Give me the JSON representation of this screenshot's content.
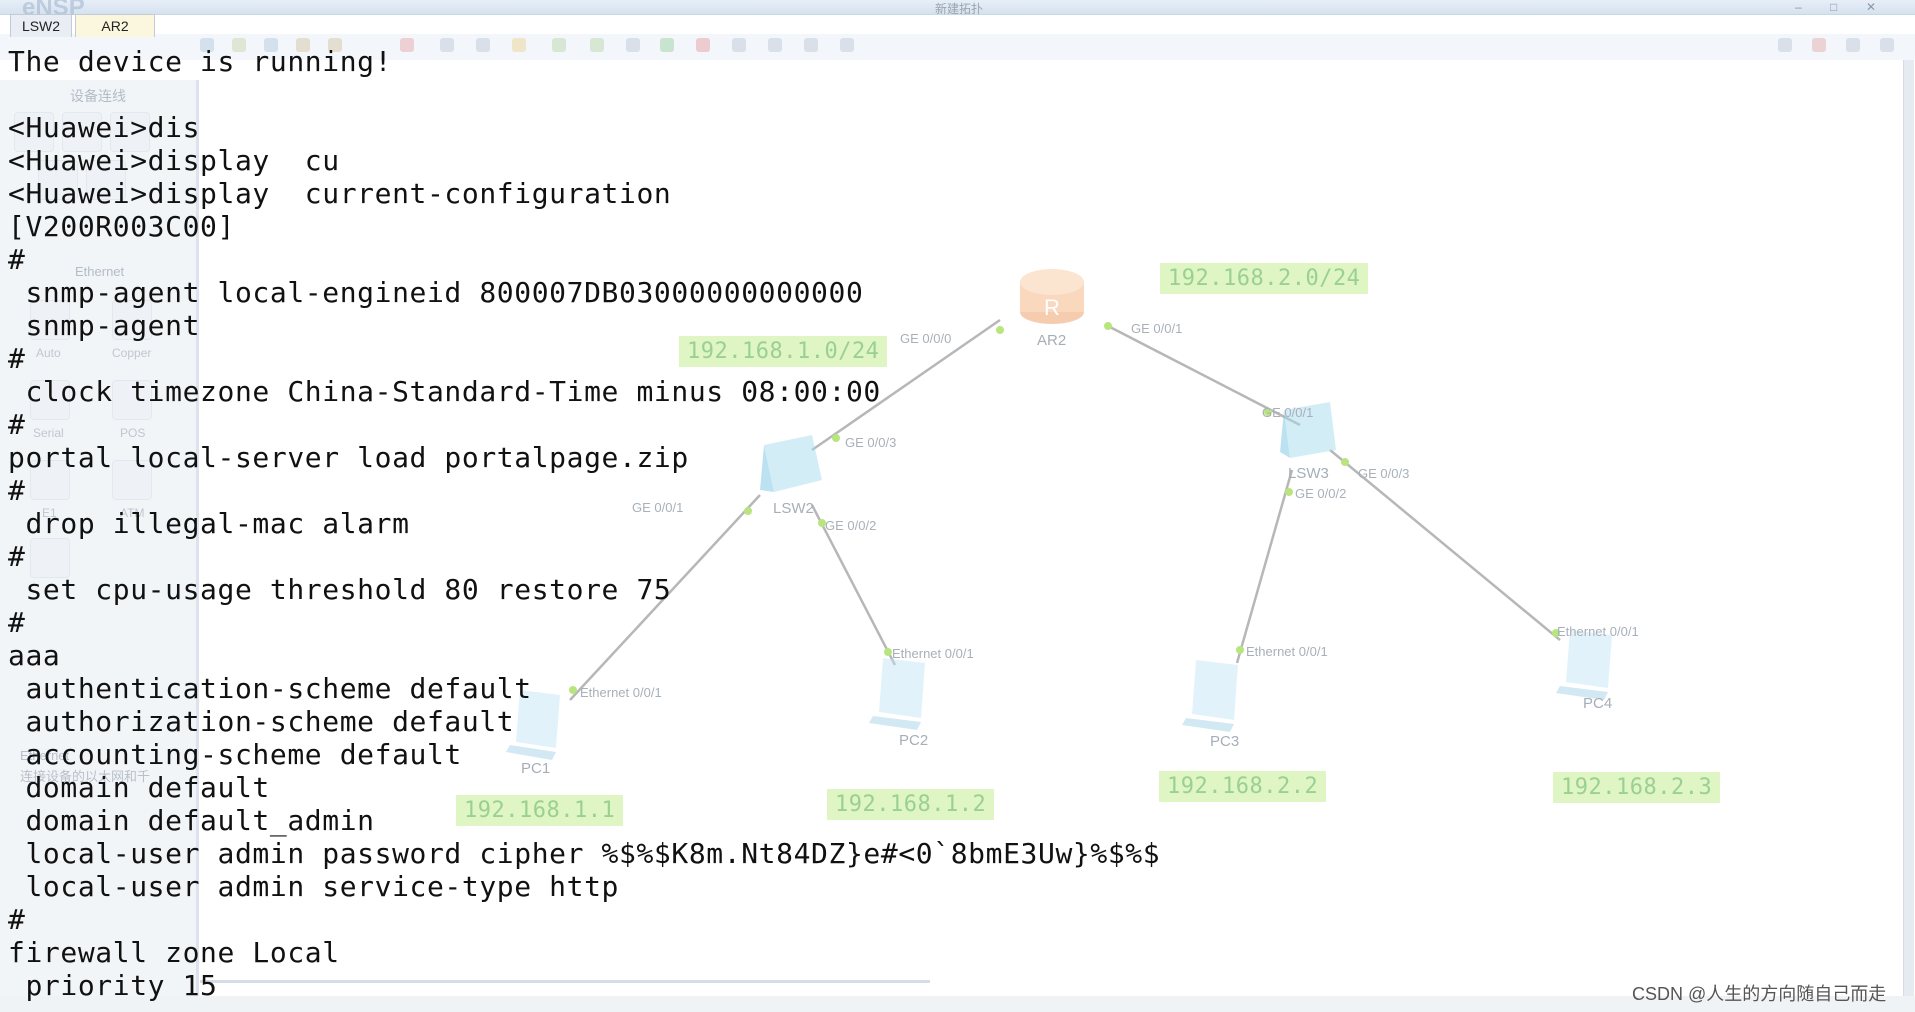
{
  "window": {
    "app_name": "eNSP",
    "title": "新建拓扑"
  },
  "tabs": [
    {
      "label": "LSW2"
    },
    {
      "label": "AR2"
    }
  ],
  "sidebar": {
    "title": "设备连线",
    "ethernet_title": "Ethernet",
    "cable_types": [
      "Auto",
      "Copper",
      "Serial",
      "POS",
      "E1",
      "ATM"
    ],
    "description_title": "Ethernet",
    "description": "连接设备的以太网和千"
  },
  "console": {
    "lines": [
      "The device is running!",
      "",
      "<Huawei>dis",
      "<Huawei>display  cu",
      "<Huawei>display  current-configuration",
      "[V200R003C00]",
      "#",
      " snmp-agent local-engineid 800007DB03000000000000",
      " snmp-agent",
      "#",
      " clock timezone China-Standard-Time minus 08:00:00",
      "#",
      "portal local-server load portalpage.zip",
      "#",
      " drop illegal-mac alarm",
      "#",
      " set cpu-usage threshold 80 restore 75",
      "#",
      "aaa",
      " authentication-scheme default",
      " authorization-scheme default",
      " accounting-scheme default",
      " domain default",
      " domain default_admin",
      " local-user admin password cipher %$%$K8m.Nt84DZ}e#<0`8bmE3Uw}%$%$",
      " local-user admin service-type http",
      "#",
      "firewall zone Local",
      " priority 15"
    ]
  },
  "topology": {
    "devices": {
      "ar2": {
        "name": "AR2",
        "type": "router"
      },
      "lsw2": {
        "name": "LSW2",
        "type": "switch"
      },
      "lsw3": {
        "name": "LSW3",
        "type": "switch"
      },
      "pc1": {
        "name": "PC1",
        "type": "pc"
      },
      "pc2": {
        "name": "PC2",
        "type": "pc"
      },
      "pc3": {
        "name": "PC3",
        "type": "pc"
      },
      "pc4": {
        "name": "PC4",
        "type": "pc"
      }
    },
    "ports": {
      "ar2_g0": "GE 0/0/0",
      "ar2_g1": "GE 0/0/1",
      "lsw2_g3": "GE 0/0/3",
      "lsw2_g1": "GE 0/0/1",
      "lsw2_g2": "GE 0/0/2",
      "lsw3_g1": "GE 0/0/1",
      "lsw3_g3": "GE 0/0/3",
      "lsw3_g2": "GE 0/0/2",
      "pc1_e": "Ethernet 0/0/1",
      "pc2_e": "Ethernet 0/0/1",
      "pc3_e": "Ethernet 0/0/1",
      "pc4_e": "Ethernet 0/0/1"
    },
    "network_labels": {
      "net1": "192.168.1.0/24",
      "net2": "192.168.2.0/24",
      "pc1_ip": "192.168.1.1",
      "pc2_ip": "192.168.1.2",
      "pc3_ip": "192.168.2.2",
      "pc4_ip": "192.168.2.3"
    }
  },
  "watermark": "CSDN @人生的方向随自己而走"
}
